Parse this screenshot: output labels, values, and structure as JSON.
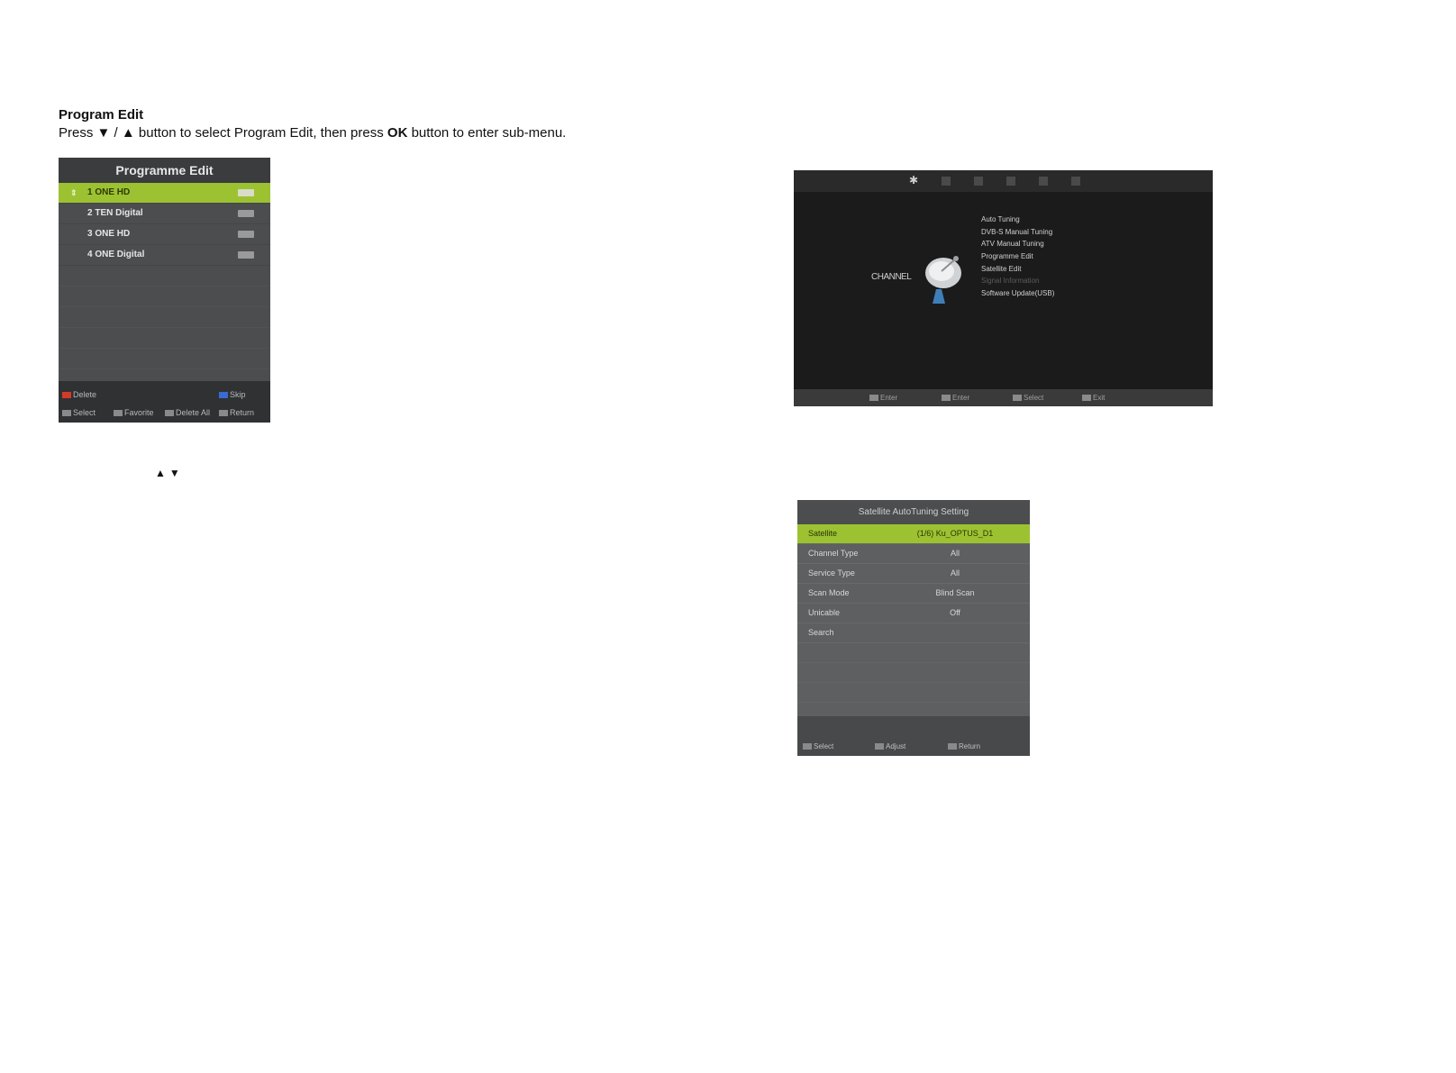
{
  "doc": {
    "heading": "Program Edit",
    "instr_pre": "Press ",
    "down_glyph": "▼",
    "slash": " / ",
    "up_glyph": "▲",
    "instr_mid": " button to select Program Edit, then press ",
    "ok": "OK",
    "instr_post": " button to enter sub-menu.",
    "arrows_note": "▲▼"
  },
  "programme_edit": {
    "title": "Programme Edit",
    "rows": [
      {
        "label": "1 ONE HD"
      },
      {
        "label": "2 TEN Digital"
      },
      {
        "label": "3 ONE HD"
      },
      {
        "label": "4 ONE Digital"
      }
    ],
    "footer": {
      "delete": "Delete",
      "skip": "Skip",
      "select": "Select",
      "favorite": "Favorite",
      "delete_all": "Delete All",
      "return": "Return"
    }
  },
  "channel_menu": {
    "side_label": "CHANNEL",
    "items": [
      "Auto Tuning",
      "DVB-S Manual Tuning",
      "ATV Manual Tuning",
      "Programme Edit",
      "Satellite Edit",
      "Signal Information",
      "Software Update(USB)"
    ],
    "footer": [
      "Enter",
      "Enter",
      "Select",
      "Exit"
    ]
  },
  "satellite_setting": {
    "title": "Satellite AutoTuning Setting",
    "rows": [
      {
        "key": "Satellite",
        "value": "(1/6) Ku_OPTUS_D1"
      },
      {
        "key": "Channel Type",
        "value": "All"
      },
      {
        "key": "Service Type",
        "value": "All"
      },
      {
        "key": "Scan Mode",
        "value": "Blind Scan"
      },
      {
        "key": "Unicable",
        "value": "Off"
      },
      {
        "key": "Search",
        "value": ""
      }
    ],
    "footer": [
      "Select",
      "Adjust",
      "Return"
    ]
  }
}
